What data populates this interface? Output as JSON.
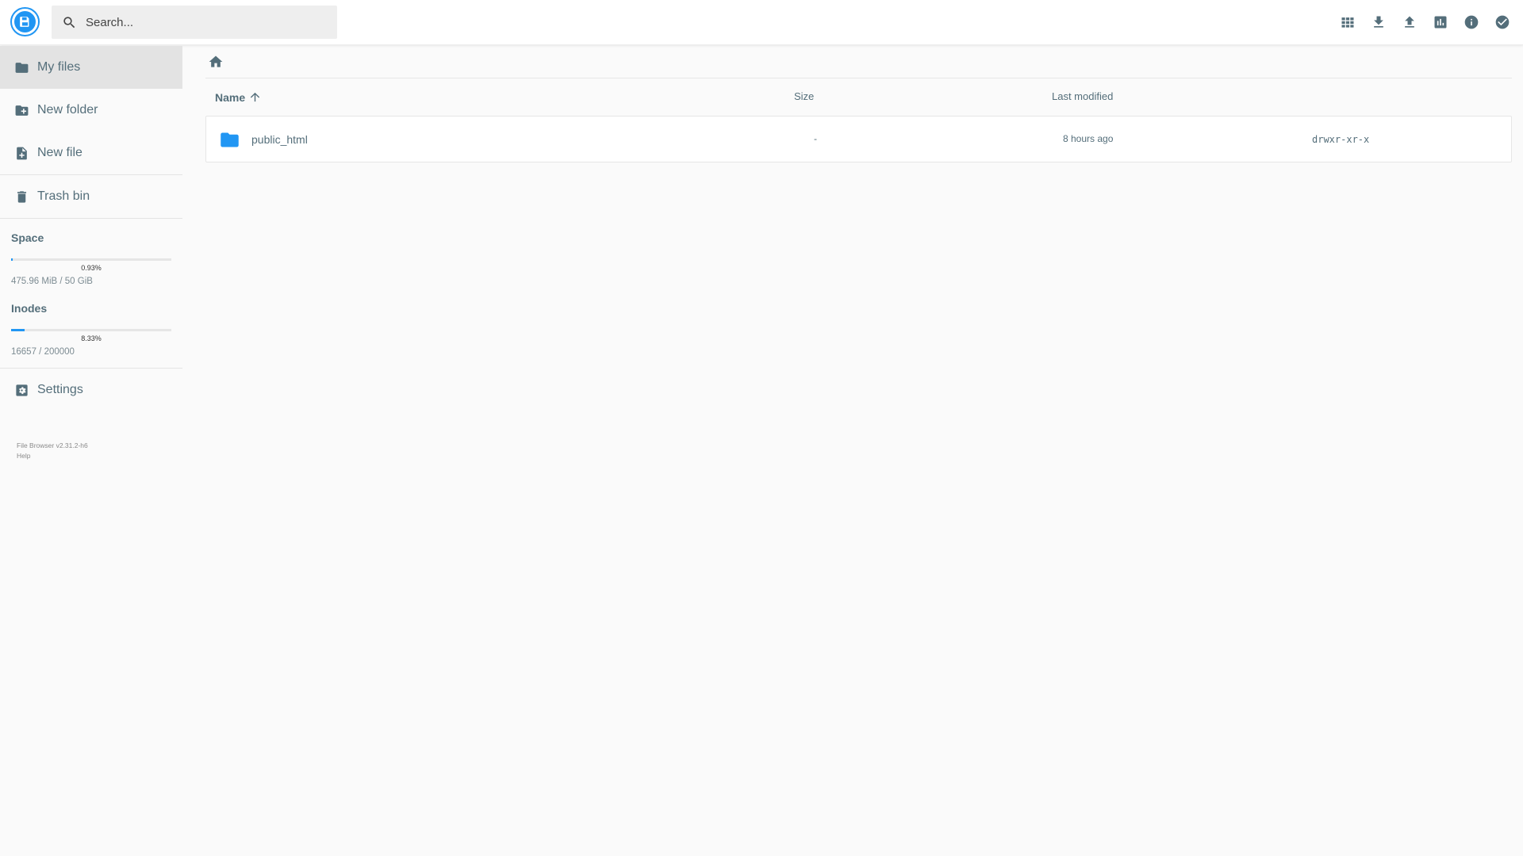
{
  "header": {
    "search_placeholder": "Search...",
    "actions": [
      "grid-view",
      "download",
      "upload",
      "disk-usage",
      "info",
      "select"
    ]
  },
  "sidebar": {
    "items": [
      {
        "label": "My files",
        "icon": "folder-icon",
        "active": true
      },
      {
        "label": "New folder",
        "icon": "folder-plus-icon"
      },
      {
        "label": "New file",
        "icon": "file-plus-icon"
      },
      {
        "label": "Trash bin",
        "icon": "trash-icon"
      }
    ],
    "space": {
      "title": "Space",
      "percent_label": "0.93%",
      "fraction": 0.0093,
      "usage": "475.96 MiB / 50 GiB"
    },
    "inodes": {
      "title": "Inodes",
      "percent_label": "8.33%",
      "fraction": 0.0833,
      "usage": "16657 / 200000"
    },
    "settings_label": "Settings",
    "version": "File Browser v2.31.2-h6",
    "help": "Help"
  },
  "listing": {
    "columns": {
      "name": "Name",
      "size": "Size",
      "modified": "Last modified"
    },
    "rows": [
      {
        "name": "public_html",
        "size": "-",
        "modified": "8 hours ago",
        "permissions": "drwxr-xr-x"
      }
    ]
  },
  "colors": {
    "accent": "#2196f3",
    "text": "#546e7a",
    "background": "#fafafa"
  }
}
